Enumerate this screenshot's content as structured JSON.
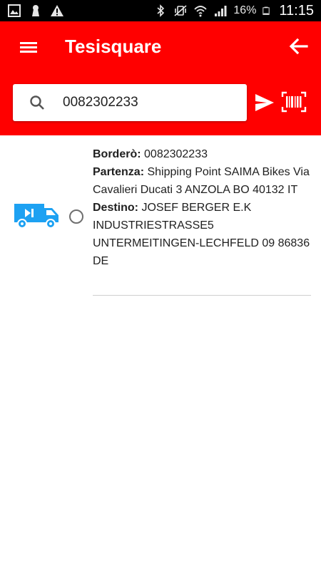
{
  "status_bar": {
    "icons": [
      "gallery-icon",
      "keyhole-icon",
      "warning-icon",
      "bluetooth-icon",
      "vibrate-icon",
      "wifi-icon",
      "signal-icon",
      "battery-icon"
    ],
    "battery": "16%",
    "time": "11:15"
  },
  "app_bar": {
    "title": "Tesisquare",
    "background_color": "#ff0000"
  },
  "search": {
    "value": "0082302233"
  },
  "items": [
    {
      "border_label": "Borderò:",
      "border_value": "0082302233",
      "departure_label": "Partenza:",
      "departure_value": "Shipping Point SAIMA Bikes Via Cavalieri Ducati 3 ANZOLA BO 40132 IT",
      "destination_label": "Destino:",
      "destination_value": "JOSEF BERGER E.K INDUSTRIESTRASSE5 UNTERMEITINGEN-LECHFELD 09 86836 DE",
      "icon": "truck-icon",
      "icon_color": "#1da1f2",
      "selected": false
    }
  ]
}
